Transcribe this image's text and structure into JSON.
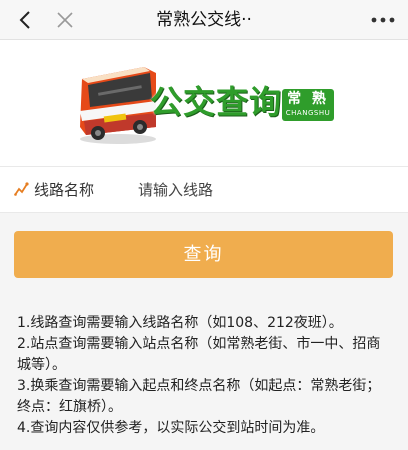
{
  "navbar": {
    "title": "常熟公交线··",
    "back_icon": "chevron-left-icon",
    "close_icon": "close-icon",
    "more_icon": "more-dots-icon"
  },
  "banner": {
    "logo_text": "公交查询",
    "badge_cn": "常 熟",
    "badge_en": "CHANGSHU",
    "colors": {
      "brand_green": "#2f9d2b"
    }
  },
  "form": {
    "route_label": "线路名称",
    "route_placeholder": "请输入线路",
    "route_value": ""
  },
  "actions": {
    "query_label": "查询",
    "colors": {
      "button": "#f0ad4e"
    }
  },
  "notes": [
    "1.线路查询需要输入线路名称（如108、212夜班）。",
    "2.站点查询需要输入站点名称（如常熟老街、市一中、招商城等）。",
    "3.换乘查询需要输入起点和终点名称（如起点：常熟老街；终点：红旗桥）。",
    "4.查询内容仅供参考，以实际公交到站时间为准。"
  ]
}
